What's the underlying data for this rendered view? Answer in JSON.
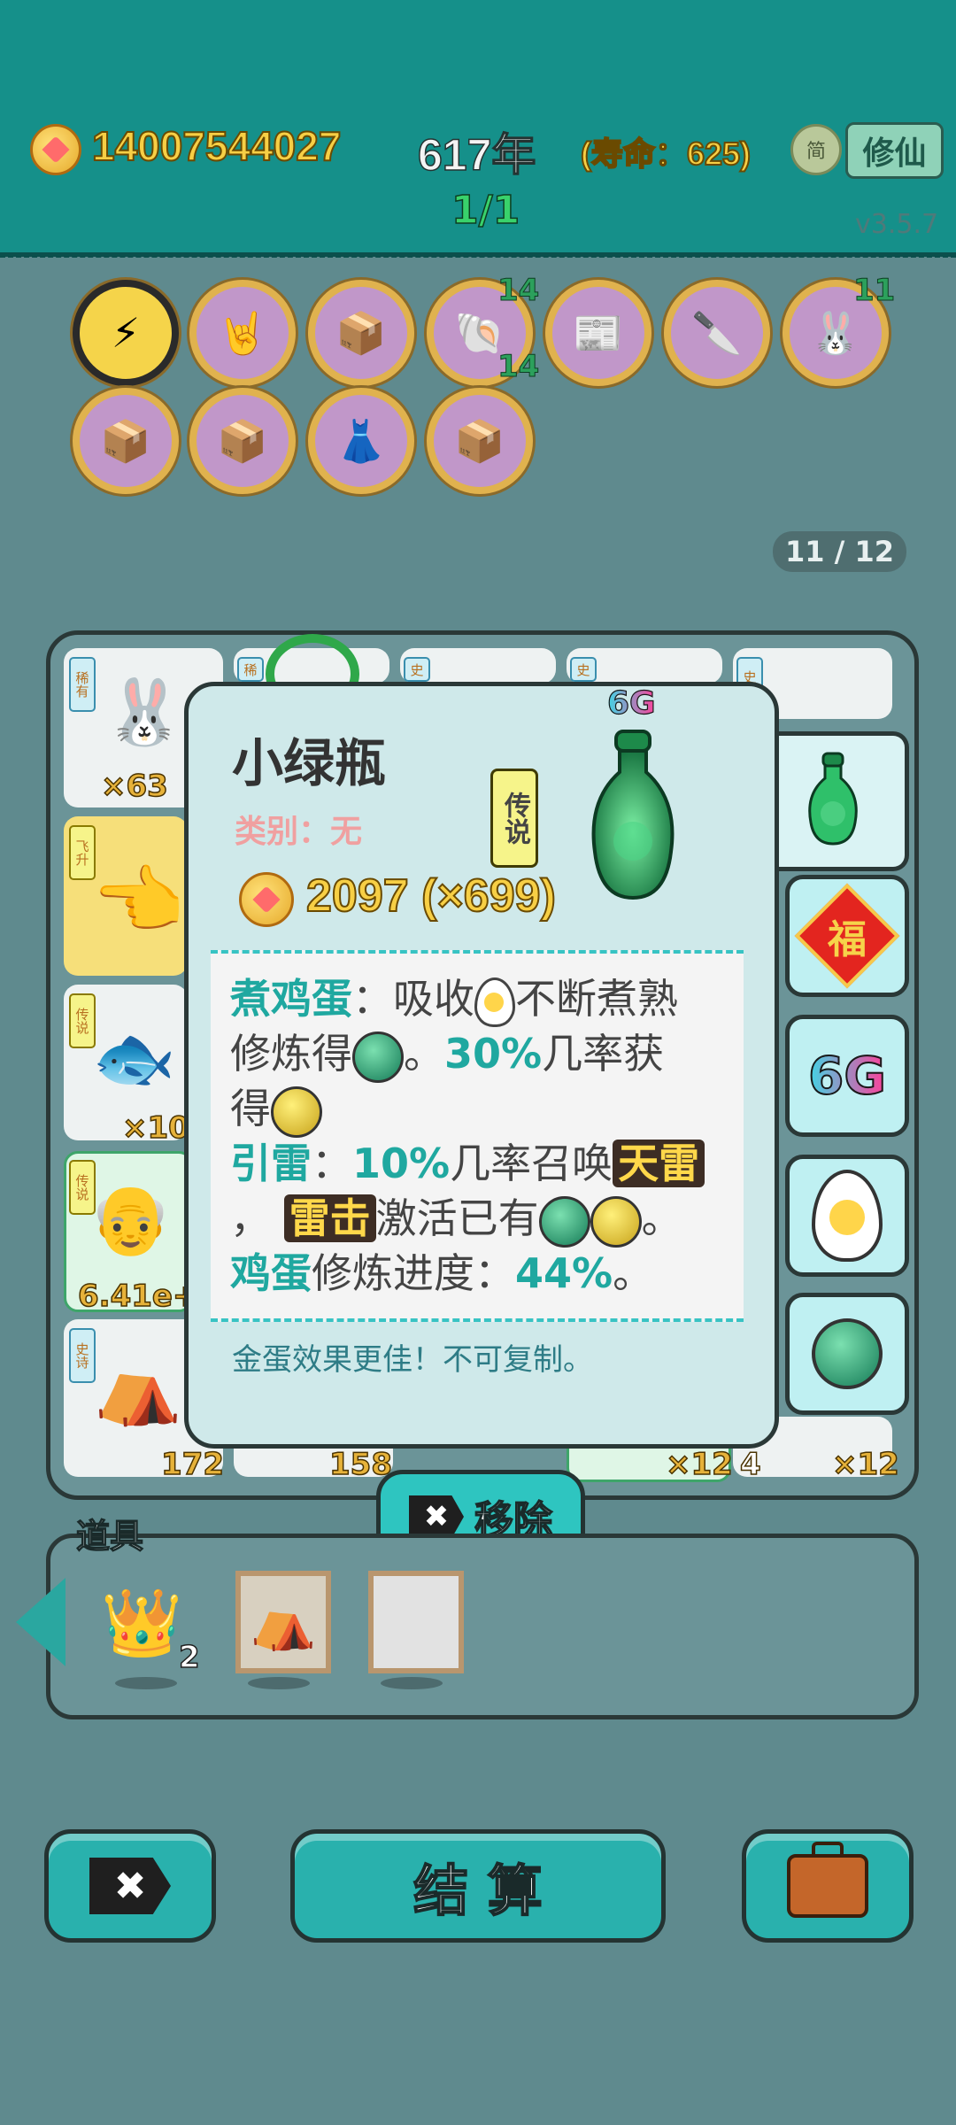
{
  "header": {
    "coins": "14007544027",
    "year": "617年",
    "lifespan": "(寿命：625)",
    "jian_label": "简",
    "xiuxian_button": "修仙",
    "round": "1/1",
    "version": "v3.5.7"
  },
  "relics": [
    {
      "icon": "lightning-icon",
      "glyph": "⚡",
      "badge_top": "",
      "badge_bottom": ""
    },
    {
      "icon": "rock-hand-icon",
      "glyph": "🤘",
      "badge_top": "",
      "badge_bottom": ""
    },
    {
      "icon": "tissue-box-icon",
      "glyph": "📦",
      "badge_top": "",
      "badge_bottom": ""
    },
    {
      "icon": "shell-icon",
      "glyph": "🐚",
      "badge_top": "14",
      "badge_bottom": "14"
    },
    {
      "icon": "time-magazine-icon",
      "glyph": "📰",
      "badge_top": "",
      "badge_bottom": ""
    },
    {
      "icon": "cleaver-icon",
      "glyph": "🔪",
      "badge_top": "",
      "badge_bottom": ""
    },
    {
      "icon": "rabbit-icon",
      "glyph": "🐰",
      "badge_top": "11",
      "badge_bottom": ""
    },
    {
      "icon": "tissue-box-icon",
      "glyph": "📦",
      "badge_top": "",
      "badge_bottom": ""
    },
    {
      "icon": "tissue-box-icon",
      "glyph": "📦",
      "badge_top": "",
      "badge_bottom": ""
    },
    {
      "icon": "skirt-icon",
      "glyph": "👗",
      "badge_top": "",
      "badge_bottom": ""
    },
    {
      "icon": "tissue-box-icon",
      "glyph": "📦",
      "badge_top": "",
      "badge_bottom": ""
    }
  ],
  "page_indicator": "11 / 12",
  "board": {
    "tags": [
      "稀有",
      "稀",
      "史",
      "史",
      "史",
      "飞升",
      "传说",
      "传说",
      "史诗"
    ],
    "counts": [
      "×63",
      "×10",
      "6.41e+",
      "172",
      "158",
      "×12",
      "4",
      "×12"
    ]
  },
  "popup": {
    "name": "小绿瓶",
    "category": "类别：无",
    "rarity": "传说",
    "tier_badge": "6G",
    "price": "2097 (×699)",
    "desc": {
      "l1_a": "煮鸡蛋",
      "l1_b": "：吸收",
      "l1_c": "不断煮熟",
      "l2_a": "修炼得",
      "l2_b": "。",
      "l2_c": "30%",
      "l2_d": "几率获",
      "l3_a": "得",
      "l4_a": "引雷",
      "l4_b": "：",
      "l4_c": "10%",
      "l4_d": "几率召唤",
      "l4_e": "天雷",
      "l5_a": "，",
      "l5_b": "雷击",
      "l5_c": "激活已有",
      "l5_d": "。",
      "l6_a": "鸡蛋",
      "l6_b": "修炼进度：",
      "l6_c": "44%",
      "l6_d": "。"
    },
    "footer": "金蛋效果更佳！不可复制。"
  },
  "side": {
    "fu": "福",
    "g6": "6G"
  },
  "remove_button": "移除",
  "items": {
    "title": "道具",
    "crown_count": "2"
  },
  "bottom": {
    "settle": "结 算"
  },
  "colors": {
    "teal_bar": "#15908a",
    "background": "#5f8a8e",
    "gold": "#f7cf45",
    "relic_purple": "#c197c9",
    "accent_teal": "#1fa8a0"
  }
}
